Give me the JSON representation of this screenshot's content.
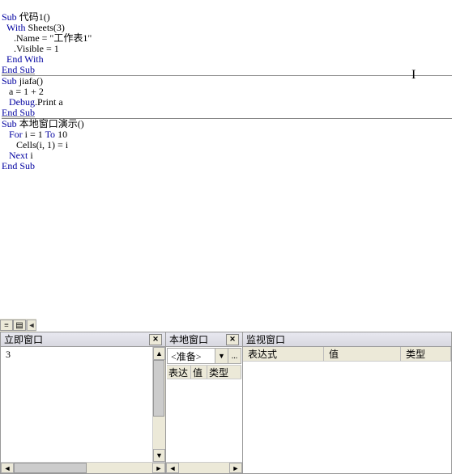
{
  "code": {
    "sub1": {
      "line1_pre": "Sub ",
      "line1_name": "代码1()",
      "line2_pre": "  With ",
      "line2_obj": "Sheets(3)",
      "line3_all": "     .Name = \"工作表1\"",
      "line4_all": "     .Visible = 1",
      "line5": "  End With",
      "line6": "End Sub"
    },
    "sub2": {
      "line1_pre": "Sub ",
      "line1_name": "jiafa()",
      "line2": "   a = 1 + 2",
      "line3_pre": "   Debug",
      "line3_post": ".Print a",
      "line4": "End Sub"
    },
    "sub3": {
      "line1_pre": "Sub ",
      "line1_name": "本地窗口演示()",
      "line2_pre": "   For ",
      "line2_mid": "i = 1 ",
      "line2_to": "To ",
      "line2_end": "10",
      "line3": "      Cells(i, 1) = i",
      "line4_pre": "   Next ",
      "line4_post": "i",
      "line5": "End Sub"
    }
  },
  "panels": {
    "immediate": {
      "title": "立即窗口",
      "value": " 3"
    },
    "locals": {
      "title": "本地窗口",
      "combo": "<准备>",
      "headers": {
        "c1": "表达",
        "c2": "值",
        "c3": "类型"
      }
    },
    "watch": {
      "title": "监视窗口",
      "headers": {
        "c1": "表达式",
        "c2": "值",
        "c3": "类型"
      }
    }
  },
  "icons": {
    "close": "✕",
    "up": "▲",
    "down": "▼",
    "left": "◄",
    "right": "►",
    "dots": "..."
  },
  "nav": {
    "b1": "≡",
    "b2": "▤"
  }
}
